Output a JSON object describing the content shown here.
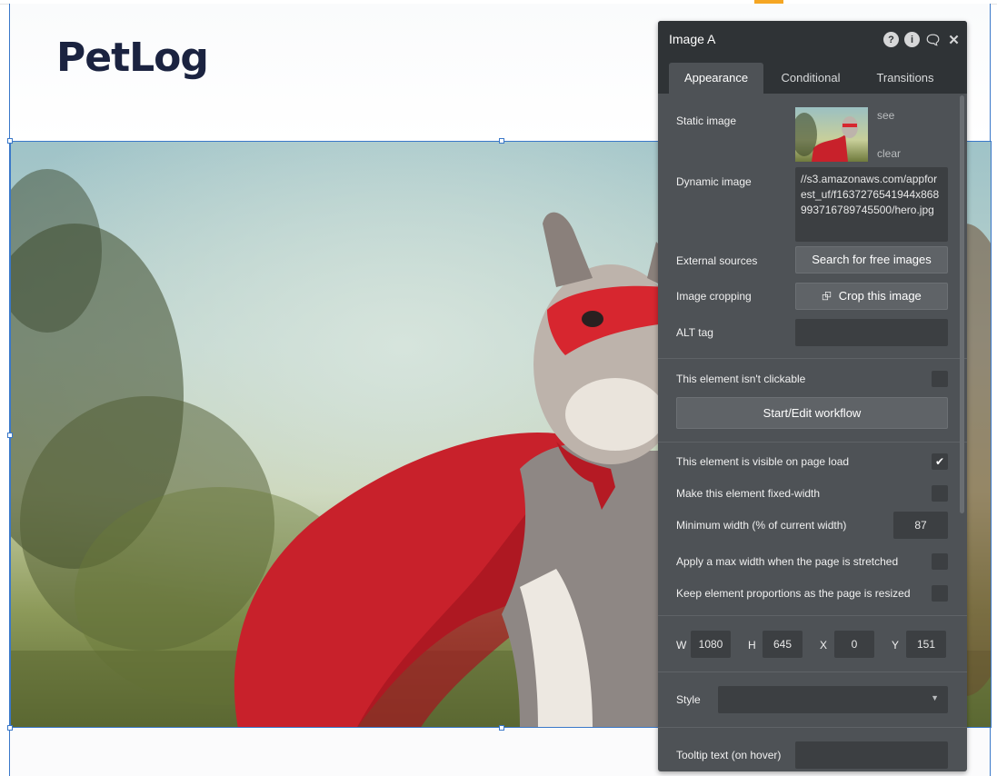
{
  "page": {
    "logo_text": "PetLog"
  },
  "panel": {
    "title": "Image A",
    "icons": [
      "help-icon",
      "info-icon",
      "comment-icon",
      "close-icon"
    ],
    "tabs": [
      {
        "label": "Appearance",
        "active": true
      },
      {
        "label": "Conditional",
        "active": false
      },
      {
        "label": "Transitions",
        "active": false
      }
    ],
    "static_image": {
      "label": "Static image",
      "see": "see",
      "clear": "clear"
    },
    "dynamic_image": {
      "label": "Dynamic image",
      "value": "//s3.amazonaws.com/appforest_uf/f1637276541944x868993716789745500/hero.jpg"
    },
    "external_sources": {
      "label": "External sources",
      "button": "Search for free images"
    },
    "image_cropping": {
      "label": "Image cropping",
      "button": "Crop this image"
    },
    "alt_tag": {
      "label": "ALT tag",
      "value": ""
    },
    "not_clickable": {
      "label": "This element isn't clickable",
      "checked": false
    },
    "workflow_button": "Start/Edit workflow",
    "visible_on_load": {
      "label": "This element is visible on page load",
      "checked": true
    },
    "fixed_width": {
      "label": "Make this element fixed-width",
      "checked": false
    },
    "min_width": {
      "label": "Minimum width (% of current width)",
      "value": "87"
    },
    "max_width": {
      "label": "Apply a max width when the page is stretched",
      "checked": false
    },
    "keep_proportions": {
      "label": "Keep element proportions as the page is resized",
      "checked": false
    },
    "dimensions": {
      "w_label": "W",
      "w": "1080",
      "h_label": "H",
      "h": "645",
      "x_label": "X",
      "x": "0",
      "y_label": "Y",
      "y": "151"
    },
    "style": {
      "label": "Style",
      "value": ""
    },
    "tooltip": {
      "label": "Tooltip text (on hover)",
      "value": ""
    }
  }
}
